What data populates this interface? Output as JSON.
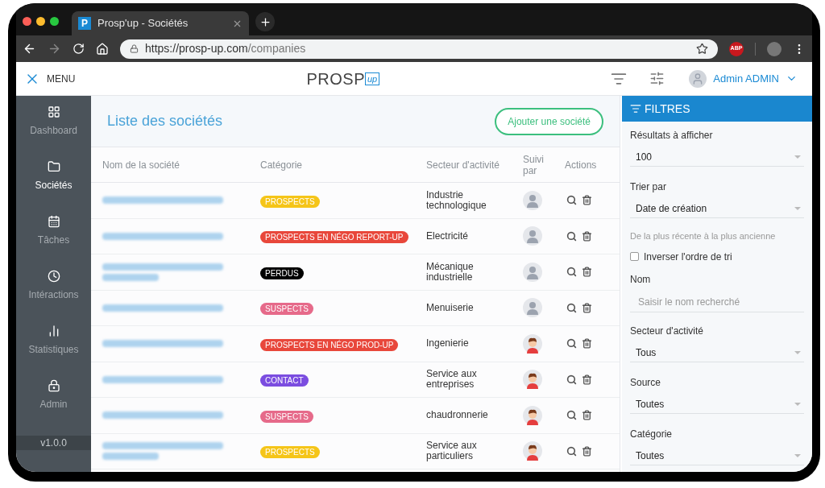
{
  "browser": {
    "tab_title": "Prosp'up - Sociétés",
    "tab_favicon": "P",
    "url_host": "https://prosp-up.com",
    "url_path": "/companies",
    "extension_badge": "ABP"
  },
  "header": {
    "menu_label": "MENU",
    "logo_text": "PROSP",
    "logo_badge": "up",
    "user_name": "Admin ADMIN"
  },
  "sidebar": {
    "items": [
      {
        "label": "Dashboard",
        "selected": false
      },
      {
        "label": "Sociétés",
        "selected": true
      },
      {
        "label": "Tâches",
        "selected": false
      },
      {
        "label": "Intéractions",
        "selected": false
      },
      {
        "label": "Statistiques",
        "selected": false
      },
      {
        "label": "Admin",
        "selected": false
      }
    ],
    "version": "v1.0.0"
  },
  "main": {
    "title": "Liste des sociétés",
    "add_button": "Ajouter une société",
    "columns": [
      "Nom de la société",
      "Catégorie",
      "Secteur d'activité",
      "Suivi par",
      "Actions"
    ],
    "rows": [
      {
        "category": "PROSPECTS",
        "color": "#f5c518",
        "sector": "Industrie technologique"
      },
      {
        "category": "PROSPECTS EN NÉGO REPORT-UP",
        "color": "#e8473b",
        "sector": "Electricité"
      },
      {
        "category": "PERDUS",
        "color": "#000000",
        "sector": "Mécanique industrielle"
      },
      {
        "category": "SUSPECTS",
        "color": "#e66a8a",
        "sector": "Menuiserie"
      },
      {
        "category": "PROSPECTS EN NÉGO PROD-UP",
        "color": "#e8473b",
        "sector": "Ingenierie"
      },
      {
        "category": "CONTACT",
        "color": "#7b4de0",
        "sector": "Service aux entreprises"
      },
      {
        "category": "SUSPECTS",
        "color": "#e66a8a",
        "sector": "chaudronnerie"
      },
      {
        "category": "PROSPECTS",
        "color": "#f5c518",
        "sector": "Service aux particuliers"
      }
    ]
  },
  "filters": {
    "title": "FILTRES",
    "fields": [
      {
        "kind": "select",
        "label": "Résultats à afficher",
        "value": "100"
      },
      {
        "kind": "select",
        "label": "Trier par",
        "value": "Date de création"
      },
      {
        "kind": "note",
        "label": "De la plus récente à la plus ancienne"
      },
      {
        "kind": "checkbox",
        "label": "Inverser l'ordre de tri",
        "checked": false
      },
      {
        "kind": "input",
        "label": "Nom",
        "placeholder": "Saisir le nom recherché"
      },
      {
        "kind": "select",
        "label": "Secteur d'activité",
        "value": "Tous"
      },
      {
        "kind": "select",
        "label": "Source",
        "value": "Toutes"
      },
      {
        "kind": "select",
        "label": "Catégorie",
        "value": "Toutes"
      }
    ]
  }
}
